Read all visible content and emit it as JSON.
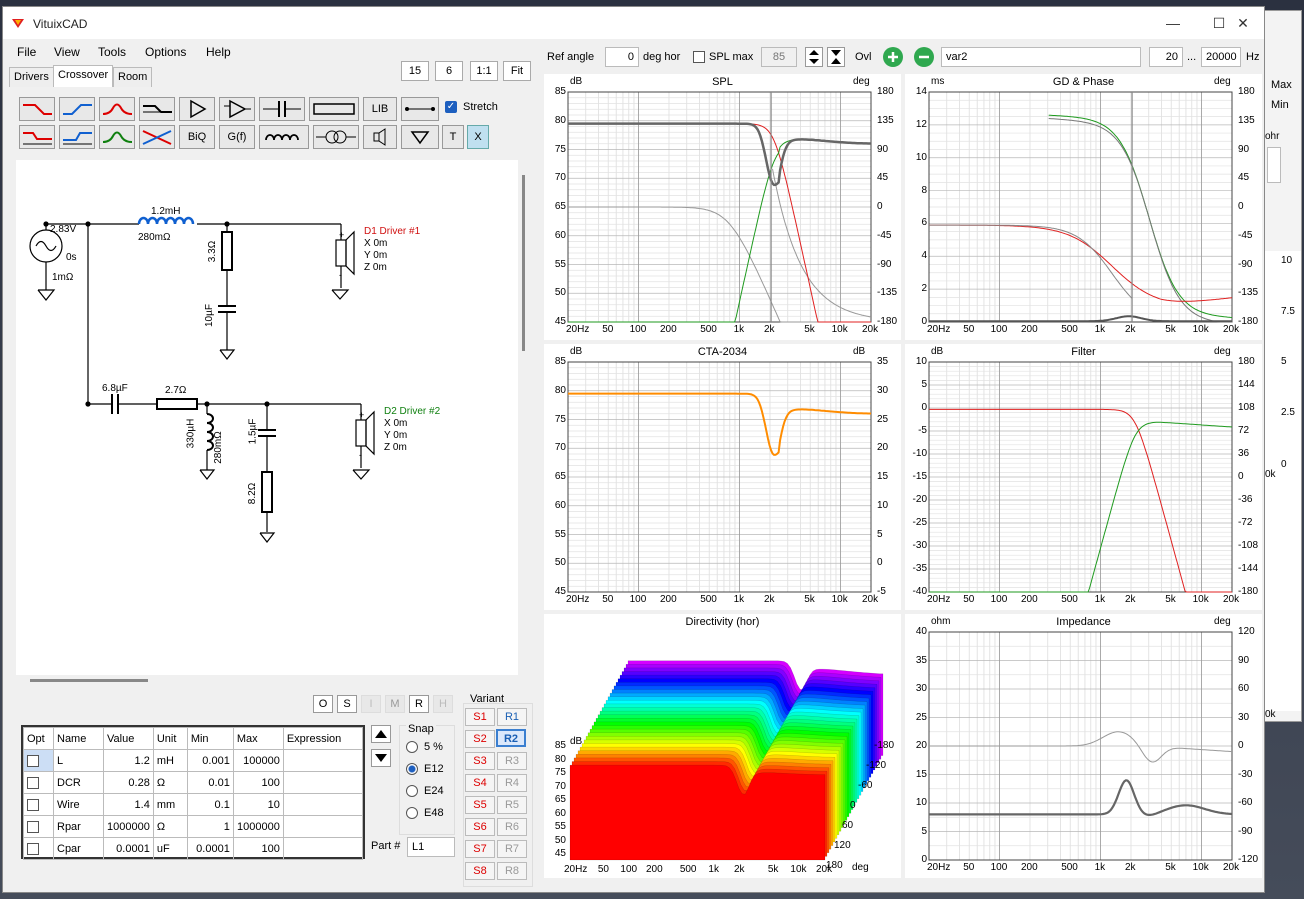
{
  "window": {
    "title": "VituixCAD",
    "min": "—",
    "max": "☐",
    "close": "✕"
  },
  "menu": [
    "File",
    "View",
    "Tools",
    "Options",
    "Help"
  ],
  "zoom": [
    "15",
    "6",
    "1:1",
    "Fit"
  ],
  "tabs": [
    "Drivers",
    "Crossover",
    "Room"
  ],
  "toolbar": {
    "lib": "LIB",
    "biq": "BiQ",
    "gf": "G(f)",
    "t": "T",
    "x": "X",
    "stretch": "Stretch"
  },
  "schematic": {
    "source": {
      "voltage": "2.83V",
      "delay": "0s",
      "r": "1mΩ"
    },
    "l1": {
      "value": "1.2mH",
      "dcr": "280mΩ"
    },
    "r1": "3.3Ω",
    "c1": "10µF",
    "d1": {
      "name": "D1 Driver #1",
      "x": "X 0m",
      "y": "Y 0m",
      "z": "Z 0m",
      "color": "#d01010"
    },
    "c2": "6.8µF",
    "r2": "2.7Ω",
    "l2": {
      "value": "330µH",
      "dcr": "280mΩ"
    },
    "c3": "1.5µF",
    "r3": "8.2Ω",
    "d2": {
      "name": "D2 Driver #2",
      "x": "X 0m",
      "y": "Y 0m",
      "z": "Z 0m",
      "color": "#108010"
    }
  },
  "osrmh": [
    "O",
    "S",
    "I",
    "M",
    "R",
    "H"
  ],
  "parts": {
    "headers": [
      "Opt",
      "Name",
      "Value",
      "Unit",
      "Min",
      "Max",
      "Expression"
    ],
    "rows": [
      {
        "name": "L",
        "value": "1.2",
        "unit": "mH",
        "min": "0.001",
        "max": "100000"
      },
      {
        "name": "DCR",
        "value": "0.28",
        "unit": "Ω",
        "min": "0.01",
        "max": "100"
      },
      {
        "name": "Wire",
        "value": "1.4",
        "unit": "mm",
        "min": "0.1",
        "max": "10"
      },
      {
        "name": "Rpar",
        "value": "1000000",
        "unit": "Ω",
        "min": "1",
        "max": "1000000"
      },
      {
        "name": "Cpar",
        "value": "0.0001",
        "unit": "uF",
        "min": "0.0001",
        "max": "100"
      }
    ],
    "part_label": "Part #",
    "part_value": "L1"
  },
  "snap": {
    "title": "Snap",
    "options": [
      "5 %",
      "E12",
      "E24",
      "E48"
    ],
    "selected": "E12"
  },
  "variant": {
    "title": "Variant",
    "s": [
      "S1",
      "S2",
      "S3",
      "S4",
      "S5",
      "S6",
      "S7",
      "S8"
    ],
    "r": [
      "R1",
      "R2",
      "R3",
      "R4",
      "R5",
      "R6",
      "R7",
      "R8"
    ],
    "selected": "R2"
  },
  "topbar": {
    "ref_angle_label": "Ref angle",
    "ref_angle": "0",
    "deg_hor": "deg hor",
    "spl_max_label": "SPL max",
    "spl_max": "85",
    "ovl": "Ovl",
    "variant_name": "var2",
    "f_low": "20",
    "dots": "...",
    "f_high": "20000",
    "hz": "Hz"
  },
  "bg_window": {
    "max": "Max",
    "min": "Min",
    "ohm": "ohr",
    "ticks": [
      "10",
      "7.5",
      "5",
      "2.5",
      "0"
    ],
    "k": "0k",
    "k2": "0k"
  },
  "charts": {
    "spl": {
      "title": "SPL",
      "lunit": "dB",
      "runit": "deg",
      "yl": [
        "85",
        "80",
        "75",
        "70",
        "65",
        "60",
        "55",
        "50",
        "45"
      ],
      "yr": [
        "180",
        "135",
        "90",
        "45",
        "0",
        "-45",
        "-90",
        "-135",
        "-180"
      ],
      "x": [
        "20Hz",
        "50",
        "100",
        "200",
        "500",
        "1k",
        "2k",
        "5k",
        "10k",
        "20k"
      ]
    },
    "gd": {
      "title": "GD & Phase",
      "lunit": "ms",
      "runit": "deg",
      "yl": [
        "14",
        "12",
        "10",
        "8",
        "6",
        "4",
        "2",
        "0"
      ],
      "yr": [
        "180",
        "135",
        "90",
        "45",
        "0",
        "-45",
        "-90",
        "-135",
        "-180"
      ],
      "x": [
        "20Hz",
        "50",
        "100",
        "200",
        "500",
        "1k",
        "2k",
        "5k",
        "10k",
        "20k"
      ]
    },
    "cta": {
      "title": "CTA-2034",
      "lunit": "dB",
      "runit": "dB",
      "yl": [
        "85",
        "80",
        "75",
        "70",
        "65",
        "60",
        "55",
        "50",
        "45"
      ],
      "yr": [
        "35",
        "30",
        "25",
        "20",
        "15",
        "10",
        "5",
        "0",
        "-5"
      ],
      "x": [
        "20Hz",
        "50",
        "100",
        "200",
        "500",
        "1k",
        "2k",
        "5k",
        "10k",
        "20k"
      ]
    },
    "filter": {
      "title": "Filter",
      "lunit": "dB",
      "runit": "deg",
      "yl": [
        "10",
        "5",
        "0",
        "-5",
        "-10",
        "-15",
        "-20",
        "-25",
        "-30",
        "-35",
        "-40"
      ],
      "yr": [
        "180",
        "144",
        "108",
        "72",
        "36",
        "0",
        "-36",
        "-72",
        "-108",
        "-144",
        "-180"
      ],
      "x": [
        "20Hz",
        "50",
        "100",
        "200",
        "500",
        "1k",
        "2k",
        "5k",
        "10k",
        "20k"
      ]
    },
    "dir": {
      "title": "Directivity (hor)",
      "unit": "dB",
      "yl": [
        "85",
        "80",
        "75",
        "70",
        "65",
        "60",
        "55",
        "50",
        "45"
      ],
      "angles": [
        "-180",
        "-120",
        "-60",
        "0",
        "60",
        "120",
        "180"
      ],
      "deg": "deg",
      "x": [
        "20Hz",
        "50",
        "100",
        "200",
        "500",
        "1k",
        "2k",
        "5k",
        "10k",
        "20k"
      ]
    },
    "imp": {
      "title": "Impedance",
      "lunit": "ohm",
      "runit": "deg",
      "yl": [
        "40",
        "35",
        "30",
        "25",
        "20",
        "15",
        "10",
        "5",
        "0"
      ],
      "yr": [
        "120",
        "90",
        "60",
        "30",
        "0",
        "-30",
        "-60",
        "-90",
        "-120"
      ],
      "x": [
        "20Hz",
        "50",
        "100",
        "200",
        "500",
        "1k",
        "2k",
        "5k",
        "10k",
        "20k"
      ]
    }
  }
}
